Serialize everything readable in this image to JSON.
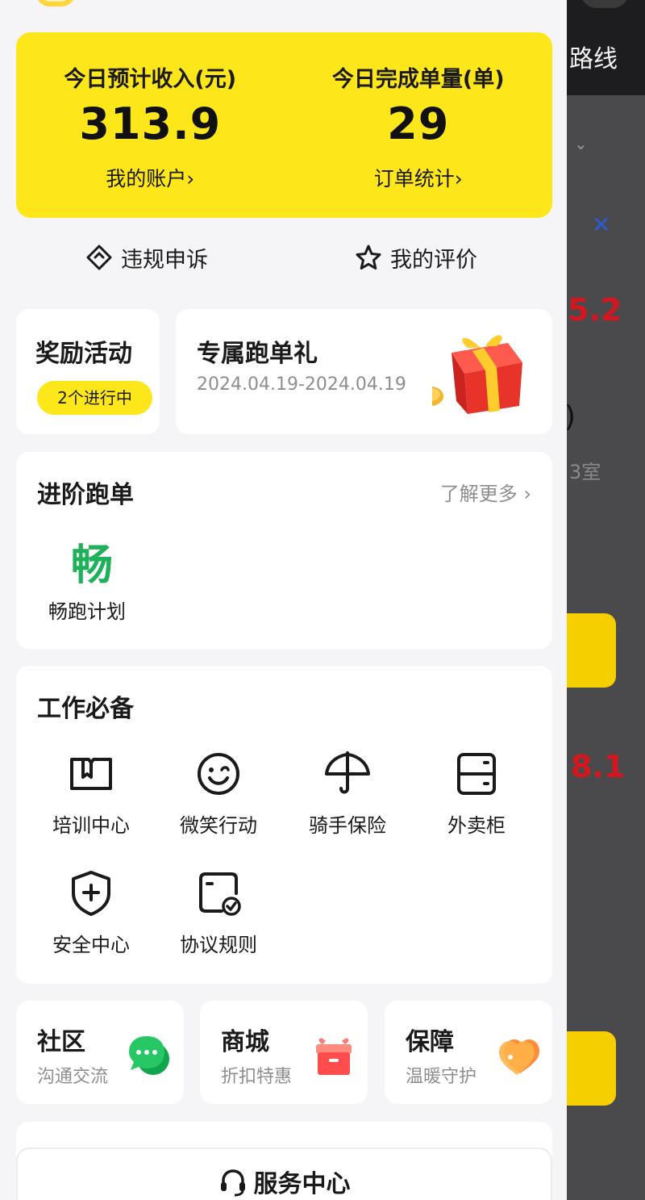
{
  "background": {
    "route_label": "路线",
    "amount_1": "5.2",
    "paren": ")",
    "room_text": "3室",
    "amount_2": "8.1"
  },
  "income": {
    "left_label": "今日预计收入(元)",
    "left_value": "313.9",
    "left_link": "我的账户›",
    "right_label": "今日完成单量(单)",
    "right_value": "29",
    "right_link": "订单统计›"
  },
  "quick_links": {
    "appeal": "违规申诉",
    "rating": "我的评价"
  },
  "reward": {
    "title": "奖励活动",
    "badge": "2个进行中"
  },
  "gift": {
    "title": "专属跑单礼",
    "date": "2024.04.19-2024.04.19"
  },
  "advanced": {
    "title": "进阶跑单",
    "more": "了解更多 ›",
    "plan_glyph": "畅",
    "plan_label": "畅跑计划"
  },
  "tools": {
    "title": "工作必备",
    "items": [
      {
        "label": "培训中心",
        "icon": "book-icon"
      },
      {
        "label": "微笑行动",
        "icon": "smile-icon"
      },
      {
        "label": "骑手保险",
        "icon": "umbrella-icon"
      },
      {
        "label": "外卖柜",
        "icon": "locker-icon"
      },
      {
        "label": "安全中心",
        "icon": "shield-plus-icon"
      },
      {
        "label": "协议规则",
        "icon": "document-check-icon"
      }
    ]
  },
  "bottom_cards": [
    {
      "title": "社区",
      "subtitle": "沟通交流",
      "icon": "chat-bubble-icon"
    },
    {
      "title": "商城",
      "subtitle": "折扣特惠",
      "icon": "gift-box-icon"
    },
    {
      "title": "保障",
      "subtitle": "温暖守护",
      "icon": "heart-icon"
    }
  ],
  "service": {
    "label": "服务中心"
  },
  "colors": {
    "accent_yellow": "#fde61a",
    "green": "#1eb15a",
    "red": "#d6161e"
  }
}
